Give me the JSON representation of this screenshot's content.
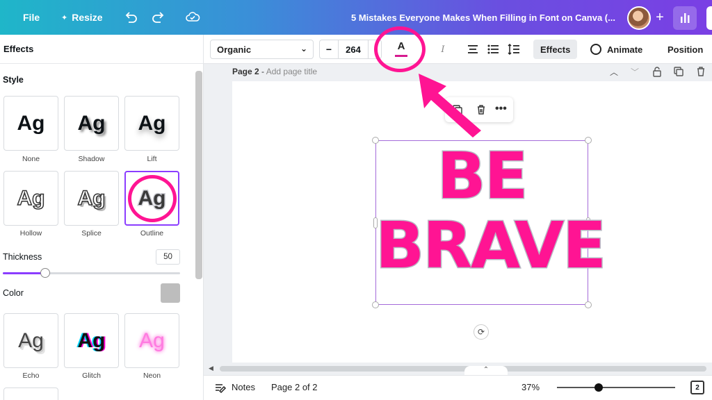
{
  "topbar": {
    "file_label": "File",
    "resize_label": "Resize",
    "resize_icon": "sparkle-icon",
    "undo_icon": "undo-icon",
    "redo_icon": "redo-icon",
    "cloud_icon": "cloud-saved-icon",
    "doc_title": "5 Mistakes Everyone Makes When Filling in Font on Canva (...",
    "plus_label": "+"
  },
  "left_panel": {
    "header": "Effects",
    "style_heading": "Style",
    "styles": [
      {
        "caption": "None",
        "sample": "Ag"
      },
      {
        "caption": "Shadow",
        "sample": "Ag"
      },
      {
        "caption": "Lift",
        "sample": "Ag"
      },
      {
        "caption": "Hollow",
        "sample": "Ag"
      },
      {
        "caption": "Splice",
        "sample": "Ag"
      },
      {
        "caption": "Outline",
        "sample": "Ag"
      },
      {
        "caption": "Echo",
        "sample": "Ag"
      },
      {
        "caption": "Glitch",
        "sample": "Ag"
      },
      {
        "caption": "Neon",
        "sample": "Ag"
      }
    ],
    "selected_style": "Outline",
    "thickness_label": "Thickness",
    "thickness_value": "50",
    "thickness_fraction": 0.24,
    "color_label": "Color",
    "color_value": "#bdbdbd"
  },
  "toolbar": {
    "font_name": "Organic",
    "size_minus": "−",
    "font_size": "264",
    "text_color_letter": "A",
    "text_color": "#d61b8f",
    "effects_label": "Effects",
    "animate_label": "Animate",
    "position_label": "Position"
  },
  "page_header": {
    "page_label": "Page 2",
    "separator": " - ",
    "title_placeholder": "Add page title"
  },
  "canvas": {
    "line1": "BE",
    "line2": "BRAVE",
    "text_fill": "#ff1493",
    "outline_color": "#b8b8c4",
    "annotation_color": "#ff1493"
  },
  "bottombar": {
    "notes_label": "Notes",
    "page_indicator": "Page 2 of 2",
    "zoom": "37%",
    "zoom_fraction": 0.35,
    "pages_count": "2"
  }
}
